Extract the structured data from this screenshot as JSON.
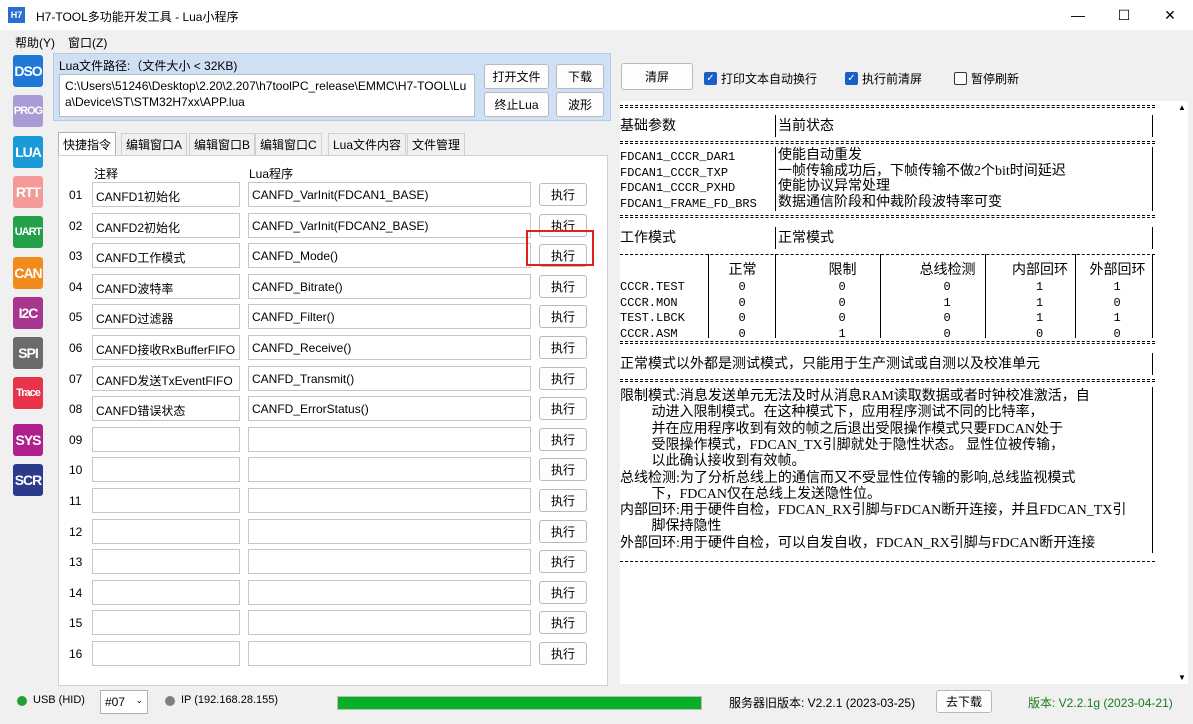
{
  "window": {
    "title": "H7-TOOL多功能开发工具 - Lua小程序",
    "icon_text": "H7",
    "minimize": "—",
    "maximize": "☐",
    "close": "✕"
  },
  "menu": {
    "help": "帮助(Y)",
    "window": "窗口(Z)"
  },
  "sidebar": [
    {
      "label": "DSO",
      "color": "#1d78d6"
    },
    {
      "label": "PROG",
      "color": "#a99bd4"
    },
    {
      "label": "LUA",
      "color": "#1a9ad9"
    },
    {
      "label": "RTT",
      "color": "#f49a98"
    },
    {
      "label": "UART",
      "color": "#22a04a"
    },
    {
      "label": "CAN",
      "color": "#f08b1c"
    },
    {
      "label": "I2C",
      "color": "#a8358e"
    },
    {
      "label": "SPI",
      "color": "#6b6b6b"
    },
    {
      "label": "Trace",
      "color": "#e8334a"
    },
    {
      "label": "SYS",
      "color": "#b01f8c"
    },
    {
      "label": "SCR",
      "color": "#2b3b8c"
    }
  ],
  "file": {
    "label": "Lua文件路径:（文件大小 < 32KB)",
    "path": "C:\\Users\\51246\\Desktop\\2.20\\2.207\\h7toolPC_release\\EMMC\\H7-TOOL\\Lua\\Device\\ST\\STM32H7xx\\APP.lua",
    "open_btn": "打开文件",
    "download_btn": "下载",
    "stop_btn": "终止Lua",
    "wave_btn": "波形"
  },
  "tabs": [
    "快捷指令",
    "编辑窗口A",
    "编辑窗口B",
    "编辑窗口C",
    "Lua文件内容",
    "文件管理"
  ],
  "quick": {
    "col_note": "注释",
    "col_lua": "Lua程序",
    "exec_label": "执行",
    "rows": [
      {
        "num": "01",
        "note": "CANFD1初始化",
        "lua": "CANFD_VarInit(FDCAN1_BASE)"
      },
      {
        "num": "02",
        "note": "CANFD2初始化",
        "lua": "CANFD_VarInit(FDCAN2_BASE)"
      },
      {
        "num": "03",
        "note": "CANFD工作模式",
        "lua": "CANFD_Mode()"
      },
      {
        "num": "04",
        "note": "CANFD波特率",
        "lua": "CANFD_Bitrate()"
      },
      {
        "num": "05",
        "note": "CANFD过滤器",
        "lua": "CANFD_Filter()"
      },
      {
        "num": "06",
        "note": "CANFD接收RxBufferFIFO",
        "lua": "CANFD_Receive()"
      },
      {
        "num": "07",
        "note": "CANFD发送TxEventFIFO",
        "lua": "CANFD_Transmit()"
      },
      {
        "num": "08",
        "note": "CANFD错误状态",
        "lua": "CANFD_ErrorStatus()"
      },
      {
        "num": "09",
        "note": "",
        "lua": ""
      },
      {
        "num": "10",
        "note": "",
        "lua": ""
      },
      {
        "num": "11",
        "note": "",
        "lua": ""
      },
      {
        "num": "12",
        "note": "",
        "lua": ""
      },
      {
        "num": "13",
        "note": "",
        "lua": ""
      },
      {
        "num": "14",
        "note": "",
        "lua": ""
      },
      {
        "num": "15",
        "note": "",
        "lua": ""
      },
      {
        "num": "16",
        "note": "",
        "lua": ""
      }
    ]
  },
  "right": {
    "clear_btn": "清屏",
    "cb_wrap": "打印文本自动换行",
    "cb_wrap_checked": true,
    "cb_clear": "执行前清屏",
    "cb_clear_checked": true,
    "cb_pause": "暂停刷新",
    "cb_pause_checked": false
  },
  "console": {
    "h_basic": "基础参数",
    "h_state": "当前状态",
    "regs": [
      {
        "name": "FDCAN1_CCCR_DAR1",
        "desc": "使能自动重发"
      },
      {
        "name": "FDCAN1_CCCR_TXP",
        "desc": "一帧传输成功后，下帧传输不做2个bit时间延迟"
      },
      {
        "name": "FDCAN1_CCCR_PXHD",
        "desc": "使能协议异常处理"
      },
      {
        "name": "FDCAN1_FRAME_FD_BRS",
        "desc": "数据通信阶段和仲裁阶段波特率可变"
      }
    ],
    "mode_label": "工作模式",
    "mode_value": "正常模式",
    "mode_cols": [
      "正常",
      "限制",
      "总线检测",
      "内部回环",
      "外部回环"
    ],
    "mode_rows": [
      {
        "name": "CCCR.TEST",
        "vals": [
          "0",
          "0",
          "0",
          "1",
          "1"
        ]
      },
      {
        "name": "CCCR.MON",
        "vals": [
          "0",
          "0",
          "1",
          "1",
          "0"
        ]
      },
      {
        "name": "TEST.LBCK",
        "vals": [
          "0",
          "0",
          "0",
          "1",
          "1"
        ]
      },
      {
        "name": "CCCR.ASM",
        "vals": [
          "0",
          "1",
          "0",
          "0",
          "0"
        ]
      }
    ],
    "note": "正常模式以外都是测试模式，只能用于生产测试或自测以及校准单元",
    "desc_lines": [
      "限制模式:消息发送单元无法及时从消息RAM读取数据或者时钟校准激活，自",
      "         动进入限制模式。在这种模式下，应用程序测试不同的比特率，",
      "         并在应用程序收到有效的帧之后退出受限操作模式只要FDCAN处于",
      "         受限操作模式，FDCAN_TX引脚就处于隐性状态。 显性位被传输，",
      "         以此确认接收到有效帧。",
      "总线检测:为了分析总线上的通信而又不受显性位传输的影响,总线监视模式",
      "         下，FDCAN仅在总线上发送隐性位。",
      "内部回环:用于硬件自检，FDCAN_RX引脚与FDCAN断开连接，并且FDCAN_TX引",
      "         脚保持隐性",
      "外部回环:用于硬件自检，可以自发自收，FDCAN_RX引脚与FDCAN断开连接"
    ]
  },
  "status": {
    "usb": "USB (HID)",
    "usb_color": "#22a033",
    "device": "#07",
    "ip": "IP (192.168.28.155)",
    "progress": 1.0,
    "server_version": "服务器旧版本: V2.2.1 (2023-03-25)",
    "download_btn": "去下载",
    "version": "版本: V2.2.1g (2023-04-21)",
    "version_color": "#1a7a1a"
  }
}
